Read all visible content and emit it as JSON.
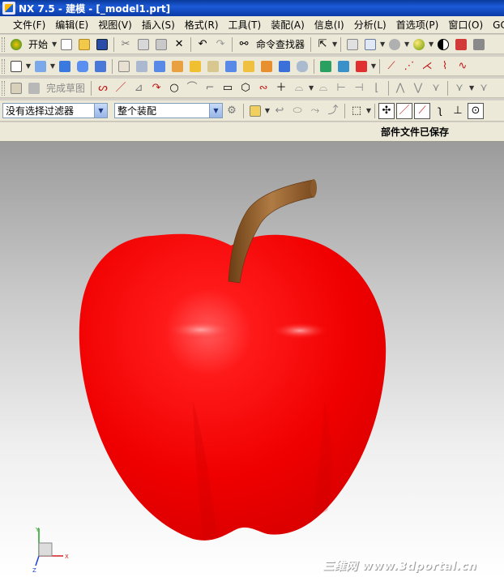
{
  "window": {
    "title": "NX 7.5 - 建模 - [_model1.prt]"
  },
  "menu": {
    "items": [
      "文件(F)",
      "编辑(E)",
      "视图(V)",
      "插入(S)",
      "格式(R)",
      "工具(T)",
      "装配(A)",
      "信息(I)",
      "分析(L)",
      "首选项(P)",
      "窗口(O)",
      "GC工具"
    ]
  },
  "toolbar": {
    "start_label": "开始",
    "command_finder_label": "命令查找器",
    "finish_sketch_label": "完成草图"
  },
  "selection": {
    "filter_value": "没有选择过滤器",
    "scope_value": "整个装配"
  },
  "status": {
    "message": "部件文件已保存"
  },
  "triad": {
    "x_label": "X",
    "y_label": "Y",
    "z_label": "Z"
  },
  "watermark": {
    "text": "三维网 www.3dportal.cn"
  },
  "colors": {
    "apple": "#ff0000",
    "stem": "#8b5a2b",
    "titlebar": "#0b3aa6"
  }
}
